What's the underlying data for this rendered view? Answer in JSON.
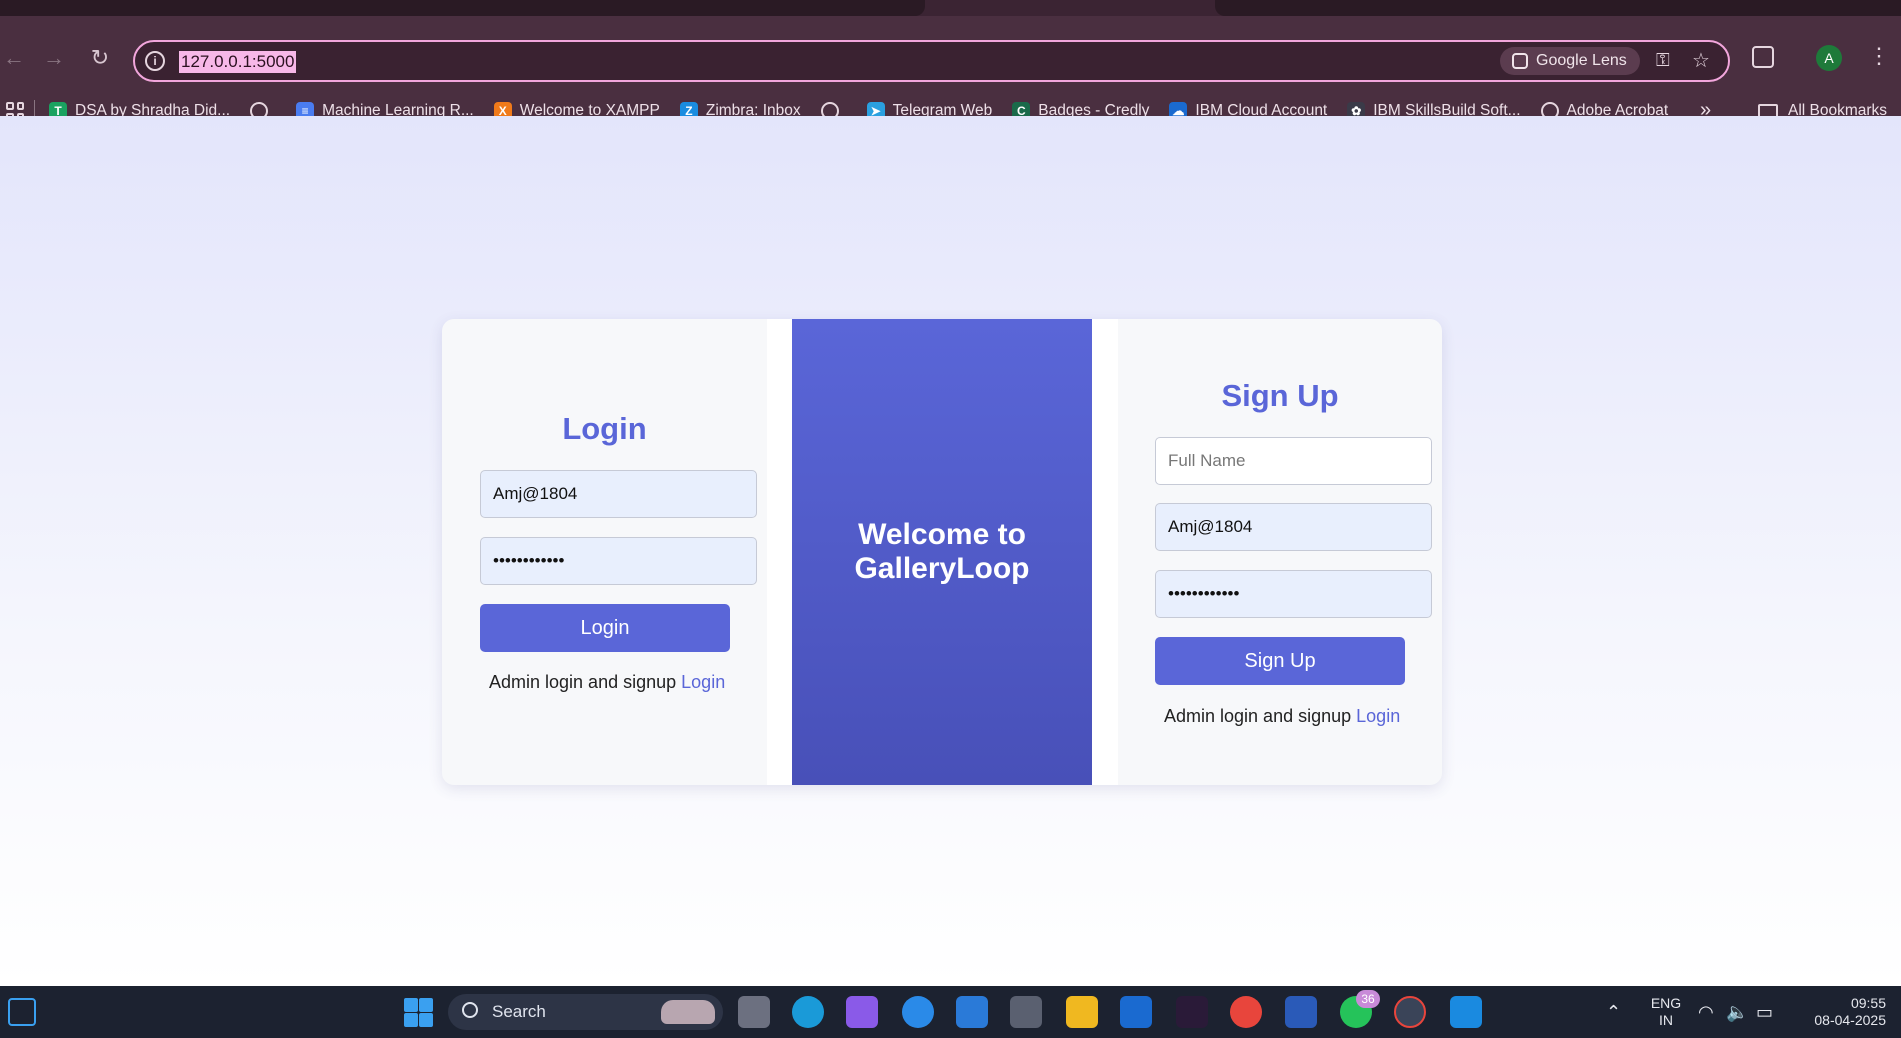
{
  "browser": {
    "url": "127.0.0.1:5000",
    "lens_label": "Google Lens",
    "avatar_letter": "A",
    "bookmarks": [
      {
        "label": "DSA by Shradha Did...",
        "color": "#1aa260",
        "glyph": "T"
      },
      {
        "label": "",
        "color": "#5a5060",
        "glyph": "globe"
      },
      {
        "label": "Machine Learning R...",
        "color": "#4a7cf0",
        "glyph": "≡"
      },
      {
        "label": "Welcome to XAMPP",
        "color": "#f07a1a",
        "glyph": "X"
      },
      {
        "label": "Zimbra: Inbox",
        "color": "#1a8ce0",
        "glyph": "Z"
      },
      {
        "label": "",
        "color": "#5a5060",
        "glyph": "globe"
      },
      {
        "label": "Telegram Web",
        "color": "#2aa0e0",
        "glyph": "➤"
      },
      {
        "label": "Badges - Credly",
        "color": "#1a6a4a",
        "glyph": "C"
      },
      {
        "label": "IBM Cloud Account",
        "color": "#1a6ad0",
        "glyph": "☁"
      },
      {
        "label": "IBM SkillsBuild Soft...",
        "color": "#3a3a48",
        "glyph": "✿"
      },
      {
        "label": "Adobe Acrobat",
        "color": "#5a5060",
        "glyph": "globe"
      }
    ],
    "all_bookmarks_label": "All Bookmarks"
  },
  "page": {
    "welcome_title": "Welcome to GalleryLoop",
    "login": {
      "title": "Login",
      "username_value": "Amj@1804",
      "password_value": "••••••••••••",
      "button_label": "Login",
      "admin_text": "Admin login and signup",
      "admin_link": "Login"
    },
    "signup": {
      "title": "Sign Up",
      "fullname_placeholder": "Full Name",
      "username_value": "Amj@1804",
      "password_value": "••••••••••••",
      "button_label": "Sign Up",
      "admin_text": "Admin login and signup",
      "admin_link": "Login"
    }
  },
  "taskbar": {
    "search_label": "Search",
    "whatsapp_badge": "36",
    "language_line1": "ENG",
    "language_line2": "IN",
    "time": "09:55",
    "date": "08-04-2025"
  }
}
